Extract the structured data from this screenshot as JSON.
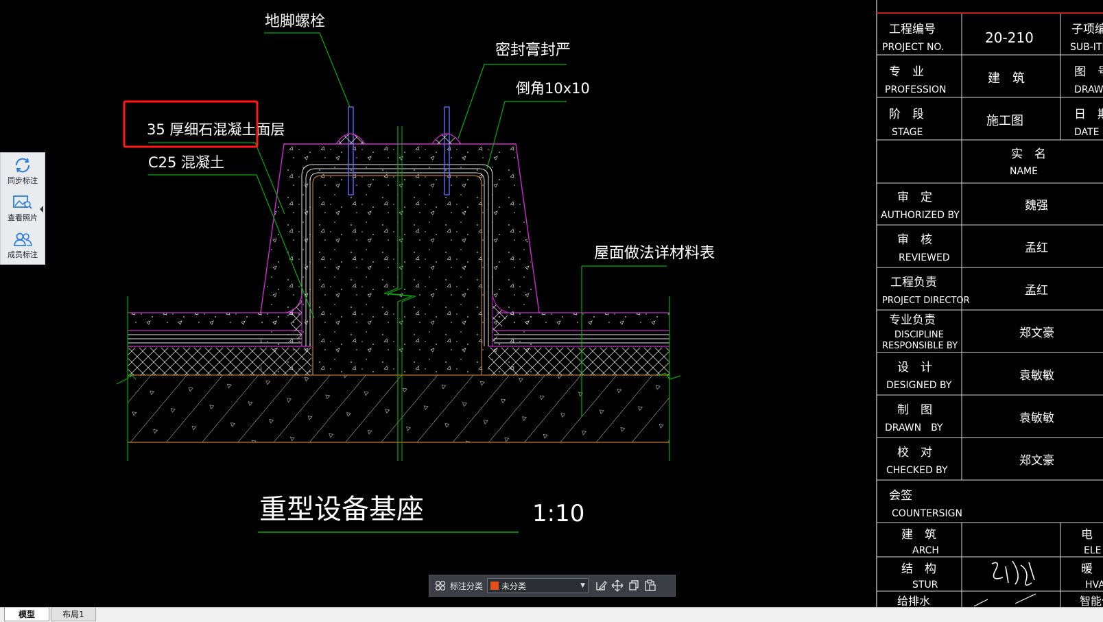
{
  "drawing": {
    "labels": {
      "anchor_bolt": "地脚螺栓",
      "sealant": "密封膏封严",
      "chamfer": "倒角10x10",
      "fine_concrete": "35 厚细石混凝土面层",
      "c25": "C25 混凝土",
      "material_table": "屋面做法详材料表"
    },
    "title": "重型设备基座",
    "scale": "1:10"
  },
  "title_block": {
    "project_no_cn": "工程编号",
    "project_no_en": "PROJECT NO.",
    "project_no_value": "20-210",
    "subitem_cn": "子项编号",
    "subitem_en": "SUB-ITEM",
    "profession_cn": "专　业",
    "profession_en": "PROFESSION",
    "profession_value": "建　筑",
    "drawing_no_cn": "图　号",
    "drawing_no_en": "DRAWING",
    "stage_cn": "阶　段",
    "stage_en": "STAGE",
    "stage_value": "施工图",
    "date_cn": "日　期",
    "date_en": "DATE",
    "name_cn": "实　名",
    "name_en": "NAME",
    "authorized_cn": "审　定",
    "authorized_en": "AUTHORIZED BY",
    "authorized_value": "魏强",
    "reviewed_cn": "审　核",
    "reviewed_en": "REVIEWED",
    "reviewed_value": "孟红",
    "director_cn": "工程负责",
    "director_en": "PROJECT DIRECTOR",
    "director_value": "孟红",
    "discipline_cn": "专业负责",
    "discipline_en1": "DISCIPLINE",
    "discipline_en2": "RESPONSIBLE BY",
    "discipline_value": "郑文豪",
    "designed_cn": "设　计",
    "designed_en": "DESIGNED BY",
    "designed_value": "袁敏敏",
    "drawn_cn": "制　图",
    "drawn_en": "DRAWN　BY",
    "drawn_value": "袁敏敏",
    "checked_cn": "校　对",
    "checked_en": "CHECKED BY",
    "checked_value": "郑文豪",
    "countersign_cn": "会签",
    "countersign_en": "COUNTERSIGN",
    "arch_cn": "建　筑",
    "arch_en": "ARCH",
    "elec_cn": "电　气",
    "elec_en": "ELE",
    "stur_cn": "结　构",
    "stur_en": "STUR",
    "hvac_cn": "暖　通",
    "hvac_en": "HVA",
    "plumbing_cn": "给排水",
    "smart_cn": "智能化"
  },
  "sidebar": {
    "sync": "同步标注",
    "photo": "查看照片",
    "member": "成员标注"
  },
  "anno_toolbar": {
    "label": "标注分类",
    "category": "未分类",
    "category_color": "#e8501a"
  },
  "tabs": {
    "model": "模型",
    "layout1": "布局1"
  },
  "colors": {
    "green": "#00b000",
    "magenta": "#d22ad2",
    "highlight": "#ff1a1a",
    "concrete": "#c07a30"
  }
}
